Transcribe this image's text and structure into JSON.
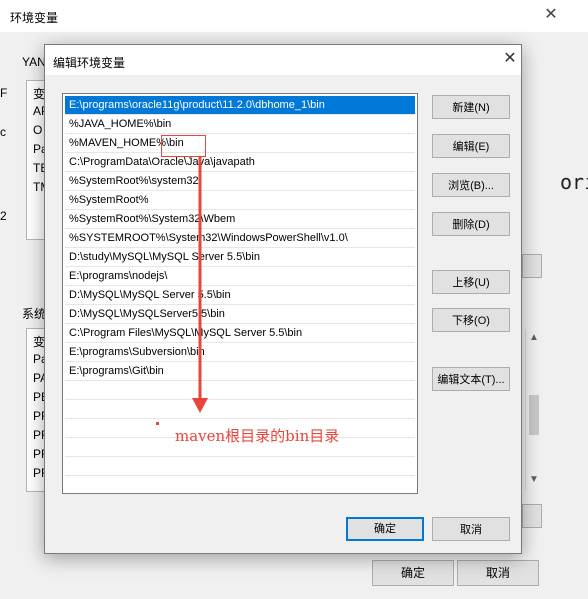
{
  "parent_window": {
    "title": "环境变量",
    "close_glyph": "✕",
    "user_vars_label": "YAN",
    "user_vars_rows": [
      "变",
      "AP",
      "O",
      "Pa",
      "TE",
      "TM"
    ],
    "sys_vars_label": "系统",
    "sys_vars_rows": [
      "变",
      "Pa",
      "PA",
      "PE",
      "PF",
      "PF",
      "PF",
      "PF"
    ],
    "left_edge_ticks": [
      "F",
      "c",
      "2"
    ],
    "right_edge_text": "ori",
    "ok_label": "确定",
    "cancel_label": "取消"
  },
  "dialog": {
    "title": "编辑环境变量",
    "close_glyph": "✕",
    "path_entries": [
      "E:\\programs\\oracle11g\\product\\11.2.0\\dbhome_1\\bin",
      "%JAVA_HOME%\\bin",
      "%MAVEN_HOME%\\bin",
      "C:\\ProgramData\\Oracle\\Java\\javapath",
      "%SystemRoot%\\system32",
      "%SystemRoot%",
      "%SystemRoot%\\System32\\Wbem",
      "%SYSTEMROOT%\\System32\\WindowsPowerShell\\v1.0\\",
      "D:\\study\\MySQL\\MySQL Server 5.5\\bin",
      "E:\\programs\\nodejs\\",
      "D:\\MySQL\\MySQL Server 5.5\\bin",
      "D:\\MySQL\\MySQLServer5.5\\bin",
      "C:\\Program Files\\MySQL\\MySQL Server 5.5\\bin",
      "E:\\programs\\Subversion\\bin",
      "E:\\programs\\Git\\bin"
    ],
    "selected_index": 0,
    "buttons": {
      "new": "新建(N)",
      "edit": "编辑(E)",
      "browse": "浏览(B)...",
      "delete": "删除(D)",
      "move_up": "上移(U)",
      "move_down": "下移(O)",
      "edit_text": "编辑文本(T)..."
    },
    "ok_label": "确定",
    "cancel_label": "取消"
  },
  "annotation": {
    "text": "maven根目录的bin目录",
    "color": "#e8453c"
  },
  "colors": {
    "selection": "#0078d7",
    "annotation": "#e8453c"
  }
}
